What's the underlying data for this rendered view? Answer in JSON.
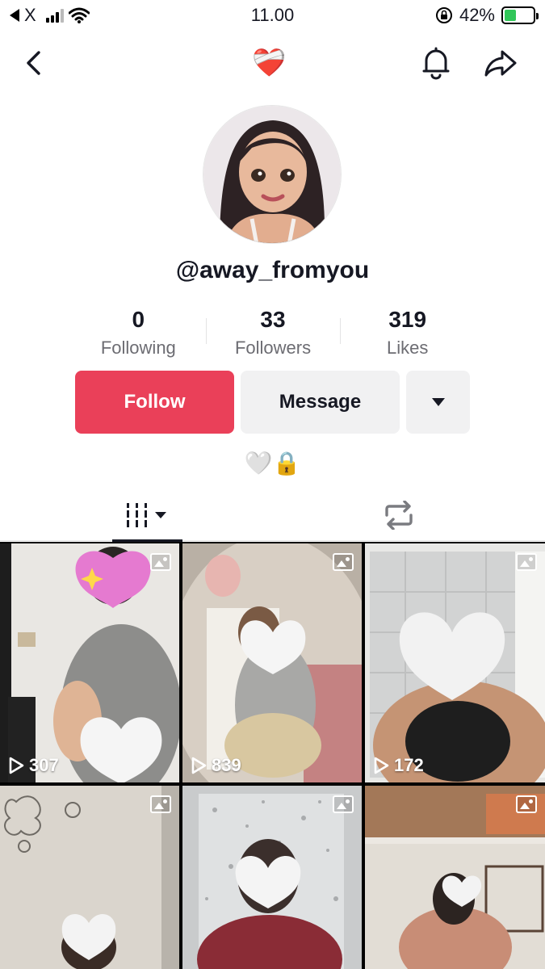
{
  "status_bar": {
    "back_app": "X",
    "time": "11.00",
    "battery_pct": "42%",
    "battery_level": 0.42,
    "colors": {
      "battery": "#31c659"
    }
  },
  "nav": {
    "back_icon": "chevron-left-icon",
    "title_emoji": "❤️‍🩹",
    "bell_icon": "bell-icon",
    "share_icon": "share-arrow-icon"
  },
  "profile": {
    "username": "@away_fromyou",
    "bio": "🤍🔒",
    "stats": [
      {
        "value": "0",
        "label": "Following"
      },
      {
        "value": "33",
        "label": "Followers"
      },
      {
        "value": "319",
        "label": "Likes"
      }
    ]
  },
  "actions": {
    "follow_label": "Follow",
    "message_label": "Message",
    "more_icon": "caret-down-icon",
    "colors": {
      "follow": "#ea4059",
      "secondary": "#f1f1f2"
    }
  },
  "tabs": [
    {
      "id": "videos",
      "icon": "grid-bars-icon",
      "active": true
    },
    {
      "id": "reposts",
      "icon": "repost-icon",
      "active": false
    }
  ],
  "posts": [
    {
      "views": "307",
      "type": "photo",
      "overlay": "sparkling-heart"
    },
    {
      "views": "839",
      "type": "photo",
      "overlay": "white-heart"
    },
    {
      "views": "172",
      "type": "photo",
      "overlay": "white-heart"
    },
    {
      "views": "",
      "type": "photo",
      "overlay": "white-heart"
    },
    {
      "views": "",
      "type": "photo",
      "overlay": "white-heart"
    },
    {
      "views": "",
      "type": "photo",
      "overlay": "white-heart"
    }
  ]
}
